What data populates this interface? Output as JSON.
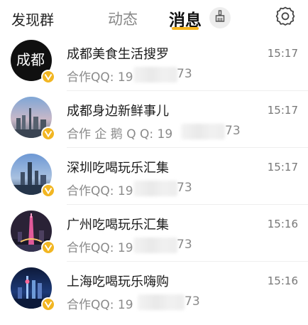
{
  "header": {
    "discover_label": "发现群",
    "feed_label": "动态",
    "messages_label": "消息",
    "accent_color": "#f6b51f"
  },
  "chats": [
    {
      "name": "成都美食生活搜罗",
      "sub_prefix": "合作QQ:  19",
      "sub_suffix": "73",
      "time": "15:17",
      "avatar_text": "成都"
    },
    {
      "name": "成都身边新鲜事儿",
      "sub_prefix": "合作  企 鹅 Q  Q:  19",
      "sub_suffix": "73",
      "time": "15:17"
    },
    {
      "name": "深圳吃喝玩乐汇集",
      "sub_prefix": "合作QQ:  19",
      "sub_suffix": "73",
      "time": "15:17"
    },
    {
      "name": "广州吃喝玩乐汇集",
      "sub_prefix": "合作QQ:  19",
      "sub_suffix": "73",
      "time": "15:16"
    },
    {
      "name": "上海吃喝玩乐嗨购",
      "sub_prefix": "合作QQ:  19",
      "sub_suffix": "73",
      "time": "15:16"
    }
  ],
  "icons": {
    "clean": "broom-icon",
    "settings": "gear-icon",
    "badge": "verified-badge-icon"
  }
}
